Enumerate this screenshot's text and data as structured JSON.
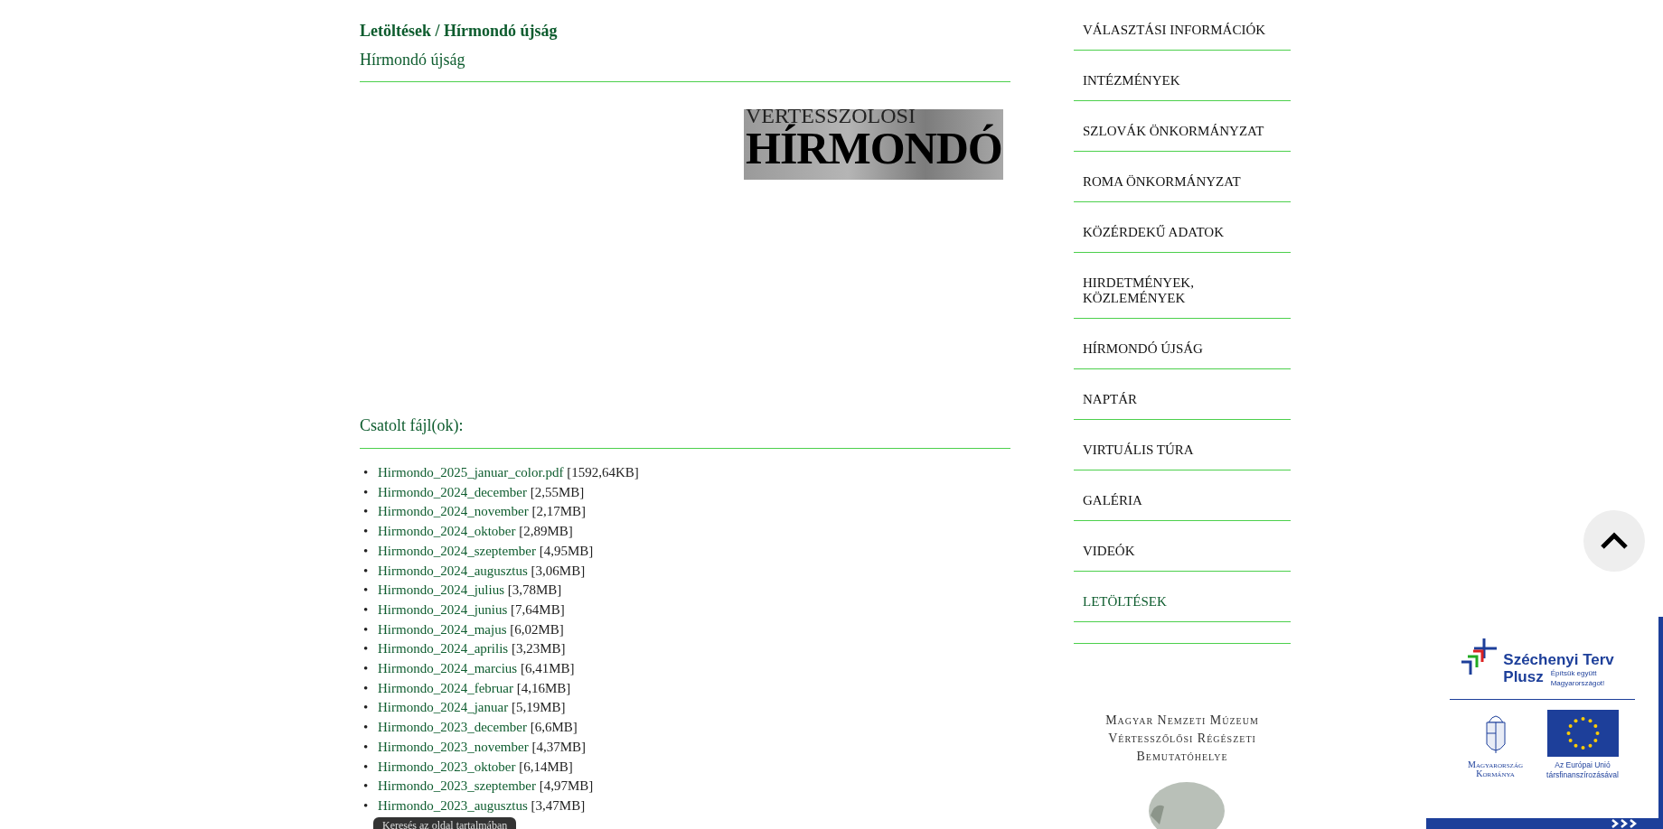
{
  "breadcrumb": {
    "parent": "Letöltések",
    "separator": "/",
    "current": "Hírmondó újság"
  },
  "page_title": "Hírmondó újság",
  "banner": {
    "line_1": "VERTESSZOLOSI",
    "line_2": "HÍRMONDÓ"
  },
  "attachments_heading": "Csatolt fájl(ok):",
  "files": [
    {
      "marker": "•",
      "name": "Hirmondo_2025_januar_color.pdf",
      "size": "[1592,64KB]"
    },
    {
      "marker": "•",
      "name": "Hirmondo_2024_december",
      "size": "[2,55MB]"
    },
    {
      "marker": "•",
      "name": "Hirmondo_2024_november",
      "size": "[2,17MB]"
    },
    {
      "marker": "•",
      "name": "Hirmondo_2024_oktober",
      "size": "[2,89MB]"
    },
    {
      "marker": "•",
      "name": "Hirmondo_2024_szeptember",
      "size": "[4,95MB]"
    },
    {
      "marker": "•",
      "name": "Hirmondo_2024_augusztus",
      "size": "[3,06MB]"
    },
    {
      "marker": "•",
      "name": "Hirmondo_2024_julius",
      "size": "[3,78MB]"
    },
    {
      "marker": "•",
      "name": "Hirmondo_2024_junius",
      "size": "[7,64MB]"
    },
    {
      "marker": "•",
      "name": "Hirmondo_2024_majus",
      "size": "[6,02MB]"
    },
    {
      "marker": "•",
      "name": "Hirmondo_2024_aprilis",
      "size": "[3,23MB]"
    },
    {
      "marker": "•",
      "name": "Hirmondo_2024_marcius",
      "size": "[6,41MB]"
    },
    {
      "marker": "•",
      "name": "Hirmondo_2024_februar",
      "size": "[4,16MB]"
    },
    {
      "marker": "•",
      "name": "Hirmondo_2024_januar",
      "size": "[5,19MB]"
    },
    {
      "marker": "•",
      "name": "Hirmondo_2023_december",
      "size": "[6,6MB]"
    },
    {
      "marker": "•",
      "name": "Hirmondo_2023_november",
      "size": "[4,37MB]"
    },
    {
      "marker": "•",
      "name": "Hirmondo_2023_oktober",
      "size": "[6,14MB]"
    },
    {
      "marker": "•",
      "name": "Hirmondo_2023_szeptember",
      "size": "[4,97MB]"
    },
    {
      "marker": "•",
      "name": "Hirmondo_2023_augusztus",
      "size": "[3,47MB]"
    }
  ],
  "tooltip": "Keresés az oldal tartalmában",
  "sidebar": {
    "items": [
      {
        "label": "VÁLASZTÁSI INFORMÁCIÓK",
        "selected": false
      },
      {
        "label": "INTÉZMÉNYEK",
        "selected": false
      },
      {
        "label": "SZLOVÁK ÖNKORMÁNYZAT",
        "selected": false
      },
      {
        "label": "ROMA ÖNKORMÁNYZAT",
        "selected": false
      },
      {
        "label": "KÖZÉRDEKŰ ADATOK",
        "selected": false
      },
      {
        "label": "HIRDETMÉNYEK, KÖZLEMÉNYEK",
        "selected": false
      },
      {
        "label": "HÍRMONDÓ ÚJSÁG",
        "selected": false
      },
      {
        "label": "NAPTÁR",
        "selected": false
      },
      {
        "label": "VIRTUÁLIS TÚRA",
        "selected": false
      },
      {
        "label": "GALÉRIA",
        "selected": false
      },
      {
        "label": "VIDEÓK",
        "selected": false
      },
      {
        "label": "LETÖLTÉSEK",
        "selected": true
      }
    ],
    "museum": [
      "Magyar Nemzeti Múzeum",
      "Vértesszőlősi Régészeti",
      "Bemutatóhelye"
    ]
  },
  "badge": {
    "title": "Széchenyi Terv",
    "title_2": "Plusz",
    "slogan": "Építsük együtt Magyarországot!",
    "government": "Magyarország Kormánya",
    "eu": "Az Európai Unió társfinanszírozásával"
  }
}
